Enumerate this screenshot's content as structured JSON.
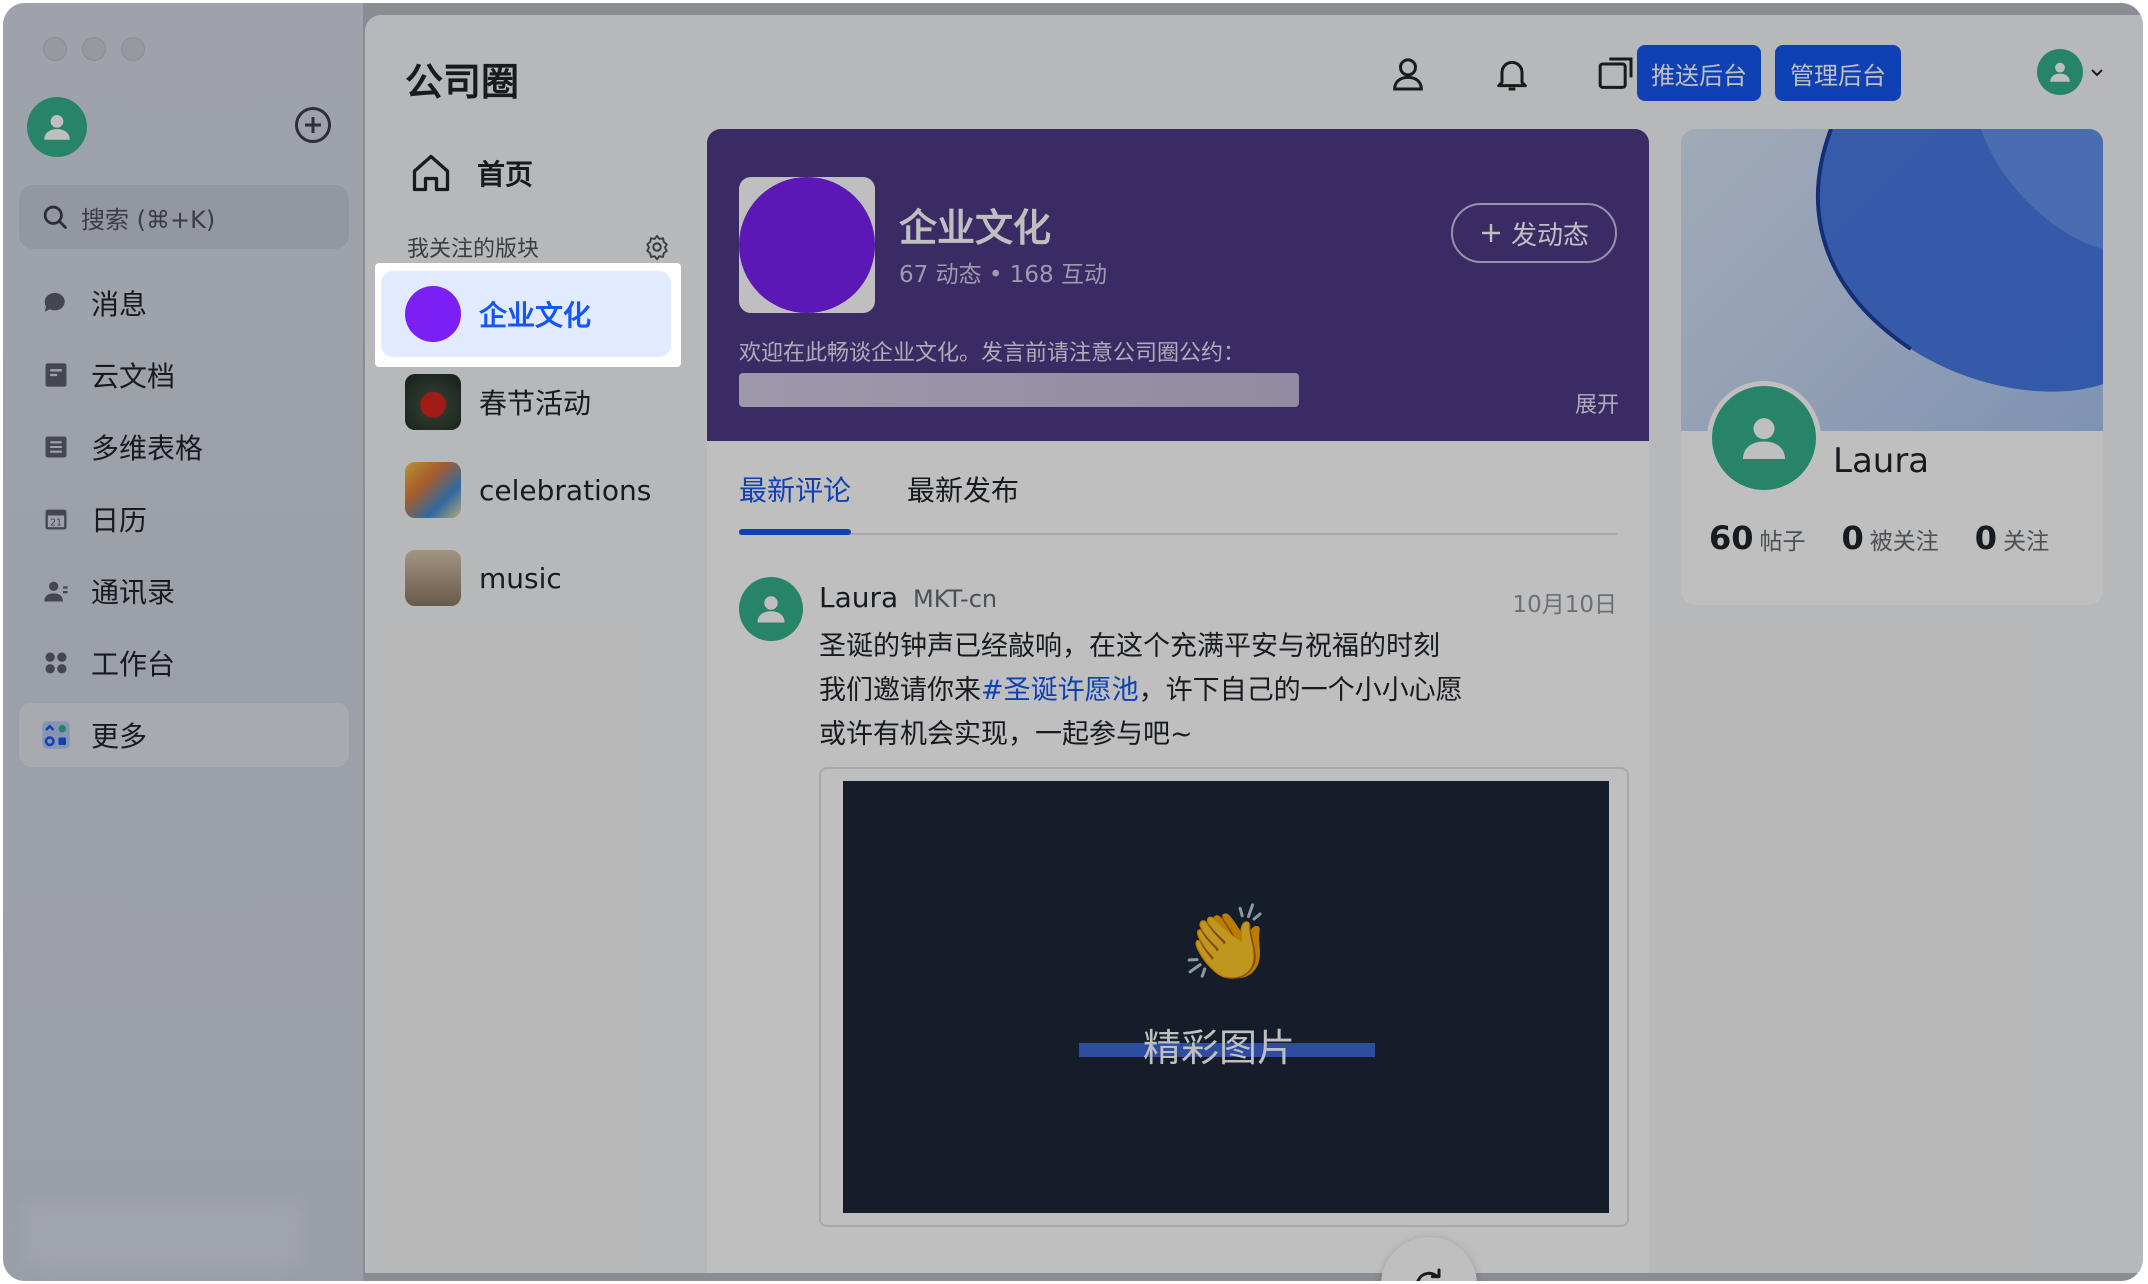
{
  "sidebar": {
    "search_placeholder": "搜索 (⌘+K)",
    "items": [
      {
        "label": "消息",
        "icon": "chat-icon"
      },
      {
        "label": "云文档",
        "icon": "docs-icon"
      },
      {
        "label": "多维表格",
        "icon": "base-icon"
      },
      {
        "label": "日历",
        "icon": "calendar-icon"
      },
      {
        "label": "通讯录",
        "icon": "contacts-icon"
      },
      {
        "label": "工作台",
        "icon": "workplace-icon"
      },
      {
        "label": "更多",
        "icon": "more-apps-icon"
      }
    ]
  },
  "header": {
    "title": "公司圈",
    "push_admin": "推送后台",
    "manage_admin": "管理后台"
  },
  "boards": {
    "home": "首页",
    "section_title": "我关注的版块",
    "items": [
      {
        "label": "企业文化"
      },
      {
        "label": "春节活动"
      },
      {
        "label": "celebrations"
      },
      {
        "label": "music"
      }
    ]
  },
  "banner": {
    "name": "企业文化",
    "stats": "67 动态  •  168 互动",
    "post_button": "发动态",
    "description": "欢迎在此畅谈企业文化。发言前请注意公司圈公约：",
    "expand": "展开"
  },
  "feed": {
    "tabs": [
      "最新评论",
      "最新发布"
    ],
    "post": {
      "author": "Laura",
      "dept": "MKT-cn",
      "date": "10月10日",
      "line1": "圣诞的钟声已经敲响，在这个充满平安与祝福的时刻",
      "line2_pre": "我们邀请你来",
      "line2_tag": "#圣诞许愿池",
      "line2_post": "，许下自己的一个小小心愿",
      "line3": "或许有机会实现，一起参与吧~",
      "media_title": "精彩图片",
      "media_emoji": "👏"
    }
  },
  "profile": {
    "name": "Laura",
    "posts": "60",
    "posts_label": "帖子",
    "followers": "0",
    "followers_label": "被关注",
    "following": "0",
    "following_label": "关注"
  },
  "colors": {
    "accent": "#1456f0",
    "banner": "#4f3a86",
    "avatar_green": "#34b18b",
    "board_purple": "#7b1ff5"
  }
}
